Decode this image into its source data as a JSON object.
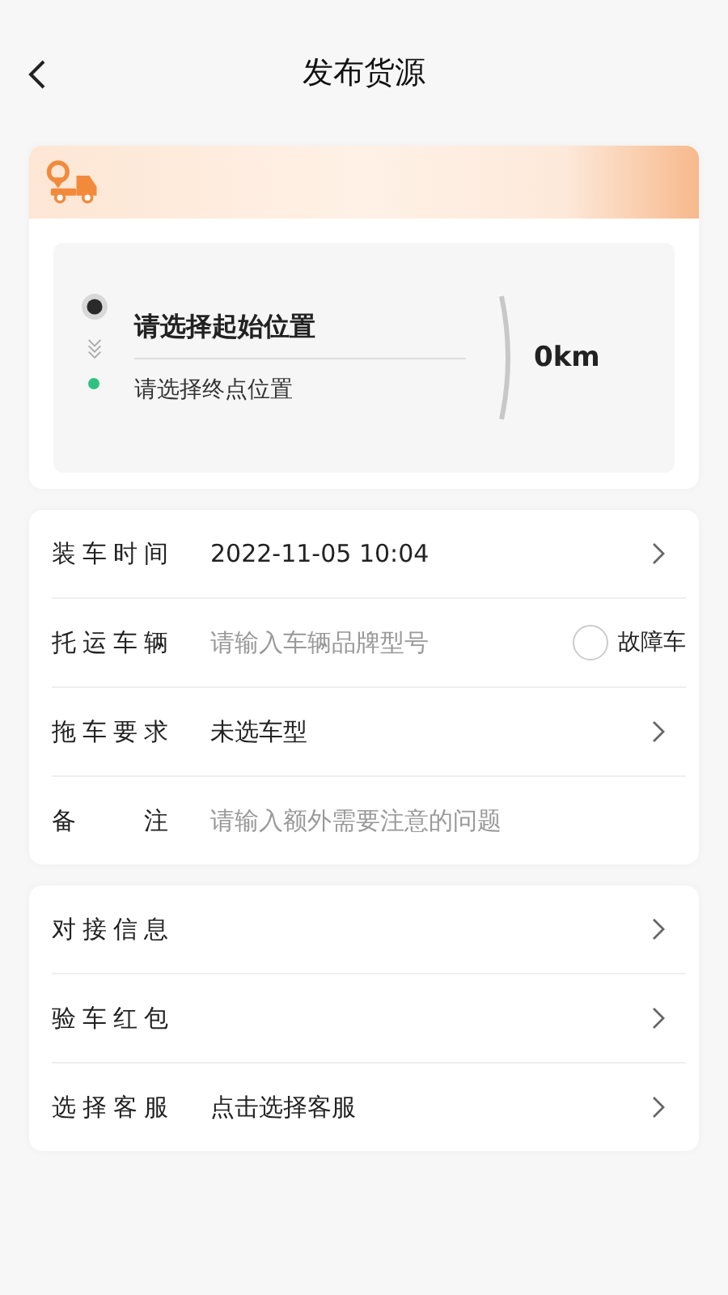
{
  "header": {
    "title": "发布货源"
  },
  "route": {
    "start": {
      "placeholder": "请选择起始位置"
    },
    "end": {
      "placeholder": "请选择终点位置"
    },
    "distance": "0km"
  },
  "form": [
    {
      "kind": "select",
      "label": "装车时间",
      "value": "2022-11-05 10:04"
    },
    {
      "kind": "input",
      "label": "托运车辆",
      "placeholder": "请输入车辆品牌型号",
      "option": {
        "label": "故障车",
        "checked": false
      }
    },
    {
      "kind": "select",
      "label": "拖车要求",
      "value": "未选车型"
    },
    {
      "kind": "input",
      "label": "备 注",
      "placeholder": "请输入额外需要注意的问题"
    }
  ],
  "links": [
    {
      "kind": "select",
      "label": "对接信息"
    },
    {
      "kind": "select",
      "label": "验车红包"
    },
    {
      "kind": "select",
      "label": "选择客服",
      "value": "点击选择客服"
    }
  ]
}
